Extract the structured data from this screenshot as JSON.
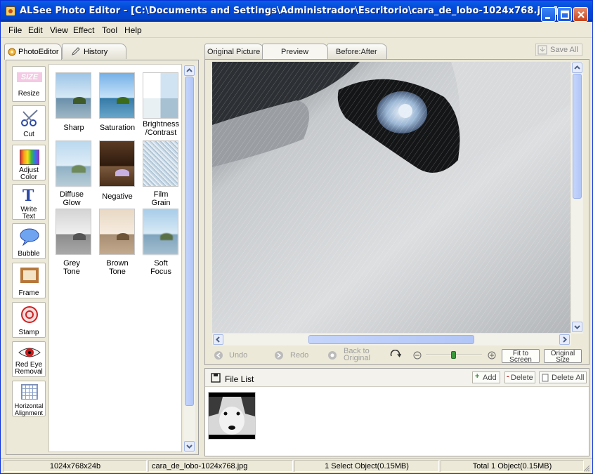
{
  "window": {
    "title": "ALSee Photo Editor - [C:\\Documents and Settings\\Administrador\\Escritorio\\cara_de_lobo-1024x768.jpg]"
  },
  "menu": [
    "File",
    "Edit",
    "View",
    "Effect",
    "Tool",
    "Help"
  ],
  "left_tabs": {
    "photo_editor": "PhotoEditor",
    "history": "History"
  },
  "tools": {
    "resize": "Resize",
    "cut": "Cut",
    "adjust_color_1": "Adjust",
    "adjust_color_2": "Color",
    "write_text_1": "Write",
    "write_text_2": "Text",
    "bubble": "Bubble",
    "frame": "Frame",
    "stamp": "Stamp",
    "red_eye_1": "Red Eye",
    "red_eye_2": "Removal",
    "halign_1": "Horizontal",
    "halign_2": "Alignment",
    "resize_icon_text": "SIZE"
  },
  "effects": {
    "sharp": "Sharp",
    "saturation": "Saturation",
    "brightness_1": "Brightness",
    "brightness_2": "/Contrast",
    "diffuse_1": "Diffuse",
    "diffuse_2": "Glow",
    "negative": "Negative",
    "film_1": "Film",
    "film_2": "Grain",
    "grey_1": "Grey",
    "grey_2": "Tone",
    "brown_1": "Brown",
    "brown_2": "Tone",
    "soft_1": "Soft",
    "soft_2": "Focus"
  },
  "view_tabs": {
    "original": "Original Picture",
    "preview": "Preview",
    "before_after": "Before:After"
  },
  "save_all": "Save All",
  "controls": {
    "undo": "Undo",
    "redo": "Redo",
    "back_1": "Back to",
    "back_2": "Original",
    "fit_1": "Fit to",
    "fit_2": "Screen",
    "orig_1": "Original",
    "orig_2": "Size",
    "zoom_level": 0.5
  },
  "file_list": {
    "title": "File List",
    "add": "Add",
    "delete": "Delete",
    "delete_all": "Delete All"
  },
  "status": {
    "dimensions": "1024x768x24b",
    "filename": "cara_de_lobo-1024x768.jpg",
    "selected": "1 Select Object(0.15MB)",
    "total": "Total 1 Object(0.15MB)"
  },
  "colors": {
    "titlebar": "#0348d8",
    "panel": "#ece9d8",
    "accent": "#316ac5"
  }
}
